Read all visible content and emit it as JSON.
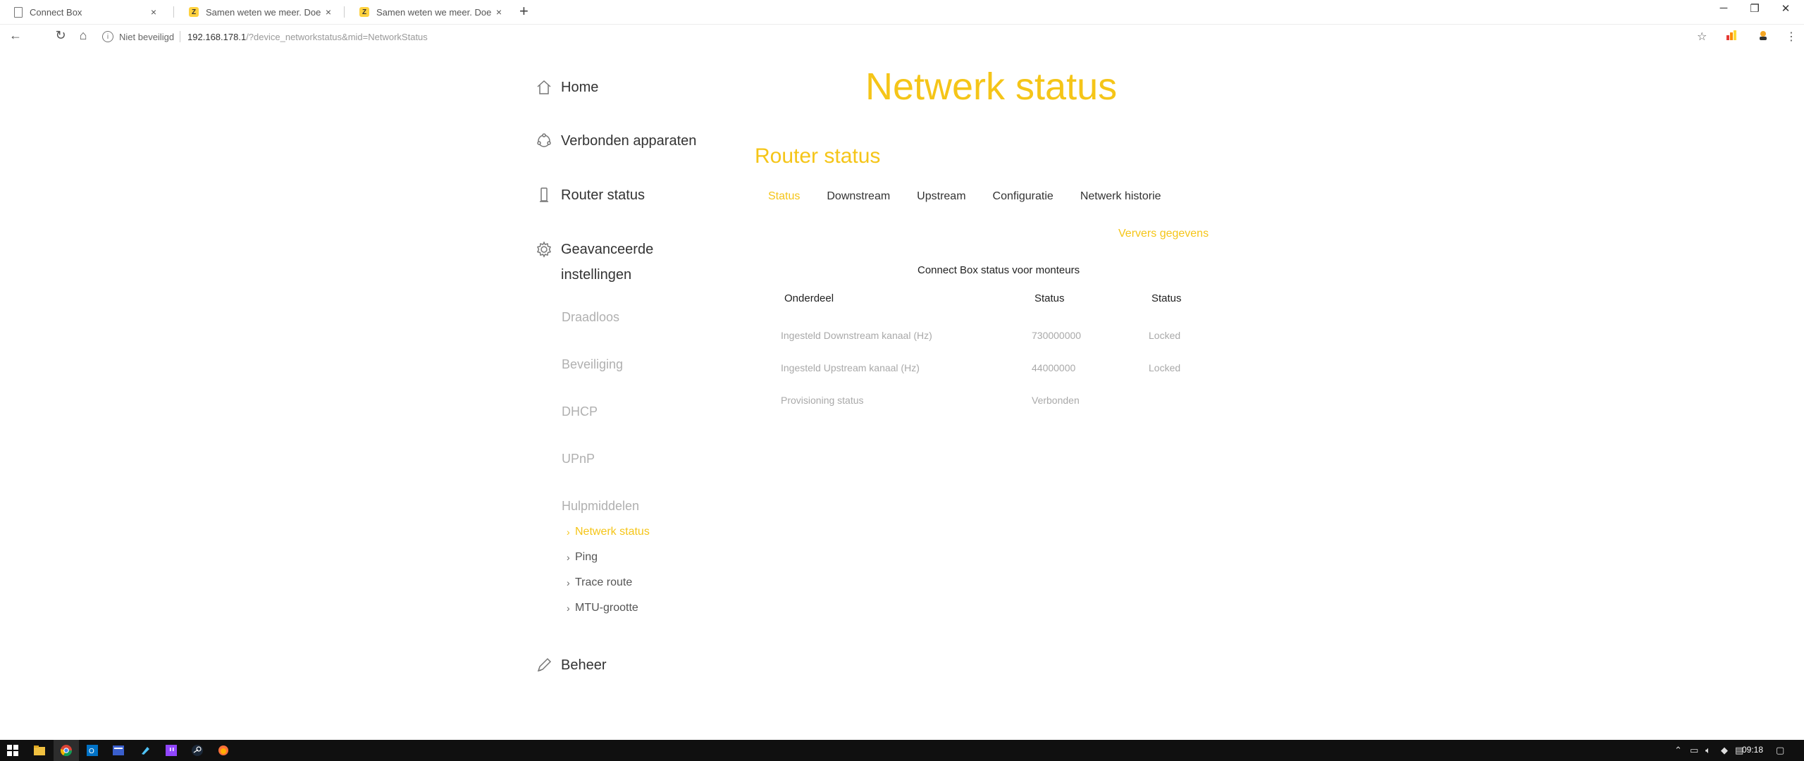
{
  "browser": {
    "tabs": [
      {
        "title": "Connect Box",
        "favicon": "page-icon",
        "active": true
      },
      {
        "title": "Samen weten we meer. Doe je m",
        "favicon": "ziggo-icon",
        "active": false
      },
      {
        "title": "Samen weten we meer. Doe je m",
        "favicon": "ziggo-icon",
        "active": false
      }
    ],
    "new_tab": "+",
    "close": "×",
    "window": {
      "minimize": "─",
      "restore": "❐",
      "close": "✕"
    },
    "address": {
      "security_label": "Niet beveiligd",
      "host": "192.168.178.1",
      "path": "/?device_networkstatus&mid=NetworkStatus"
    },
    "nav": {
      "back": "←",
      "reload": "↻",
      "home": "⌂"
    },
    "actions": {
      "star": "☆",
      "menu": "⋮"
    }
  },
  "sidebar": {
    "main": [
      {
        "label": "Home",
        "icon": "home-icon"
      },
      {
        "label": "Verbonden apparaten",
        "icon": "devices-icon"
      },
      {
        "label": "Router status",
        "icon": "router-icon"
      },
      {
        "label": "Geavanceerde instellingen",
        "icon": "gear-icon"
      }
    ],
    "advanced": [
      "Draadloos",
      "Beveiliging",
      "DHCP",
      "UPnP",
      "Hulpmiddelen"
    ],
    "tools": [
      {
        "label": "Netwerk status",
        "active": true
      },
      {
        "label": "Ping",
        "active": false
      },
      {
        "label": "Trace route",
        "active": false
      },
      {
        "label": "MTU-grootte",
        "active": false
      }
    ],
    "footer": {
      "label": "Beheer",
      "icon": "pencil-icon"
    }
  },
  "page": {
    "title": "Netwerk status",
    "section_title": "Router status",
    "tabs": [
      {
        "label": "Status",
        "active": true
      },
      {
        "label": "Downstream",
        "active": false
      },
      {
        "label": "Upstream",
        "active": false
      },
      {
        "label": "Configuratie",
        "active": false
      },
      {
        "label": "Netwerk historie",
        "active": false
      }
    ],
    "refresh_label": "Ververs gegevens",
    "table_caption": "Connect Box status voor monteurs",
    "table": {
      "headers": [
        "Onderdeel",
        "Status",
        "Status"
      ],
      "rows": [
        [
          "Ingesteld Downstream kanaal (Hz)",
          "730000000",
          "Locked"
        ],
        [
          "Ingesteld Upstream kanaal (Hz)",
          "44000000",
          "Locked"
        ],
        [
          "Provisioning status",
          "Verbonden",
          ""
        ]
      ]
    }
  },
  "taskbar": {
    "clock": "09:18"
  },
  "colors": {
    "accent": "#f5c518",
    "muted": "#a9a9a9",
    "text": "#333333",
    "taskbar": "#101010"
  }
}
